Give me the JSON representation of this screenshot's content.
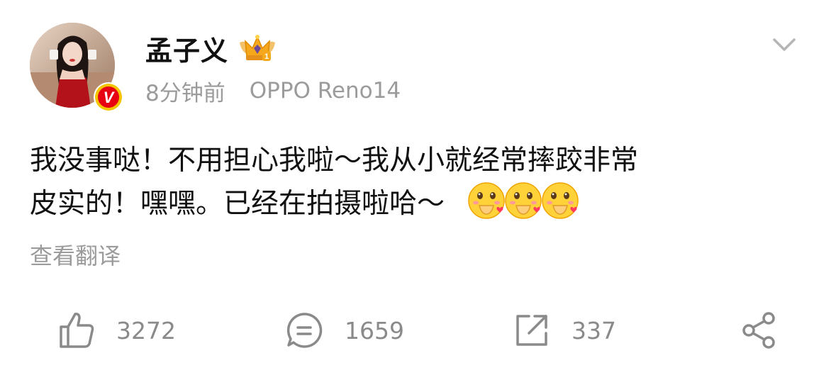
{
  "post": {
    "author": {
      "name": "孟子义",
      "badge_icon": "crown-badge-icon",
      "verified_icon": "verified-v-icon"
    },
    "meta": {
      "time": "8分钟前",
      "device": "OPPO Reno14"
    },
    "content": {
      "line1": "我没事哒！不用担心我啦～我从小就经常摔跤非常",
      "line2": "皮实的！嘿嘿。已经在拍摄啦哈～",
      "emojis": [
        "heart-hands-emoji",
        "heart-hands-emoji",
        "heart-hands-emoji"
      ]
    },
    "translate_label": "查看翻译",
    "more_icon": "chevron-down-icon",
    "actions": {
      "like": {
        "icon": "thumb-up-icon",
        "count": "3272"
      },
      "comment": {
        "icon": "comment-icon",
        "count": "1659"
      },
      "repost": {
        "icon": "repost-icon",
        "count": "337"
      },
      "share": {
        "icon": "share-icon"
      }
    }
  },
  "colors": {
    "text": "#111111",
    "meta": "#9b9b9b",
    "verified": "#e60012",
    "verified_ring": "#f5c400",
    "action_icon": "#8a8a8a"
  }
}
